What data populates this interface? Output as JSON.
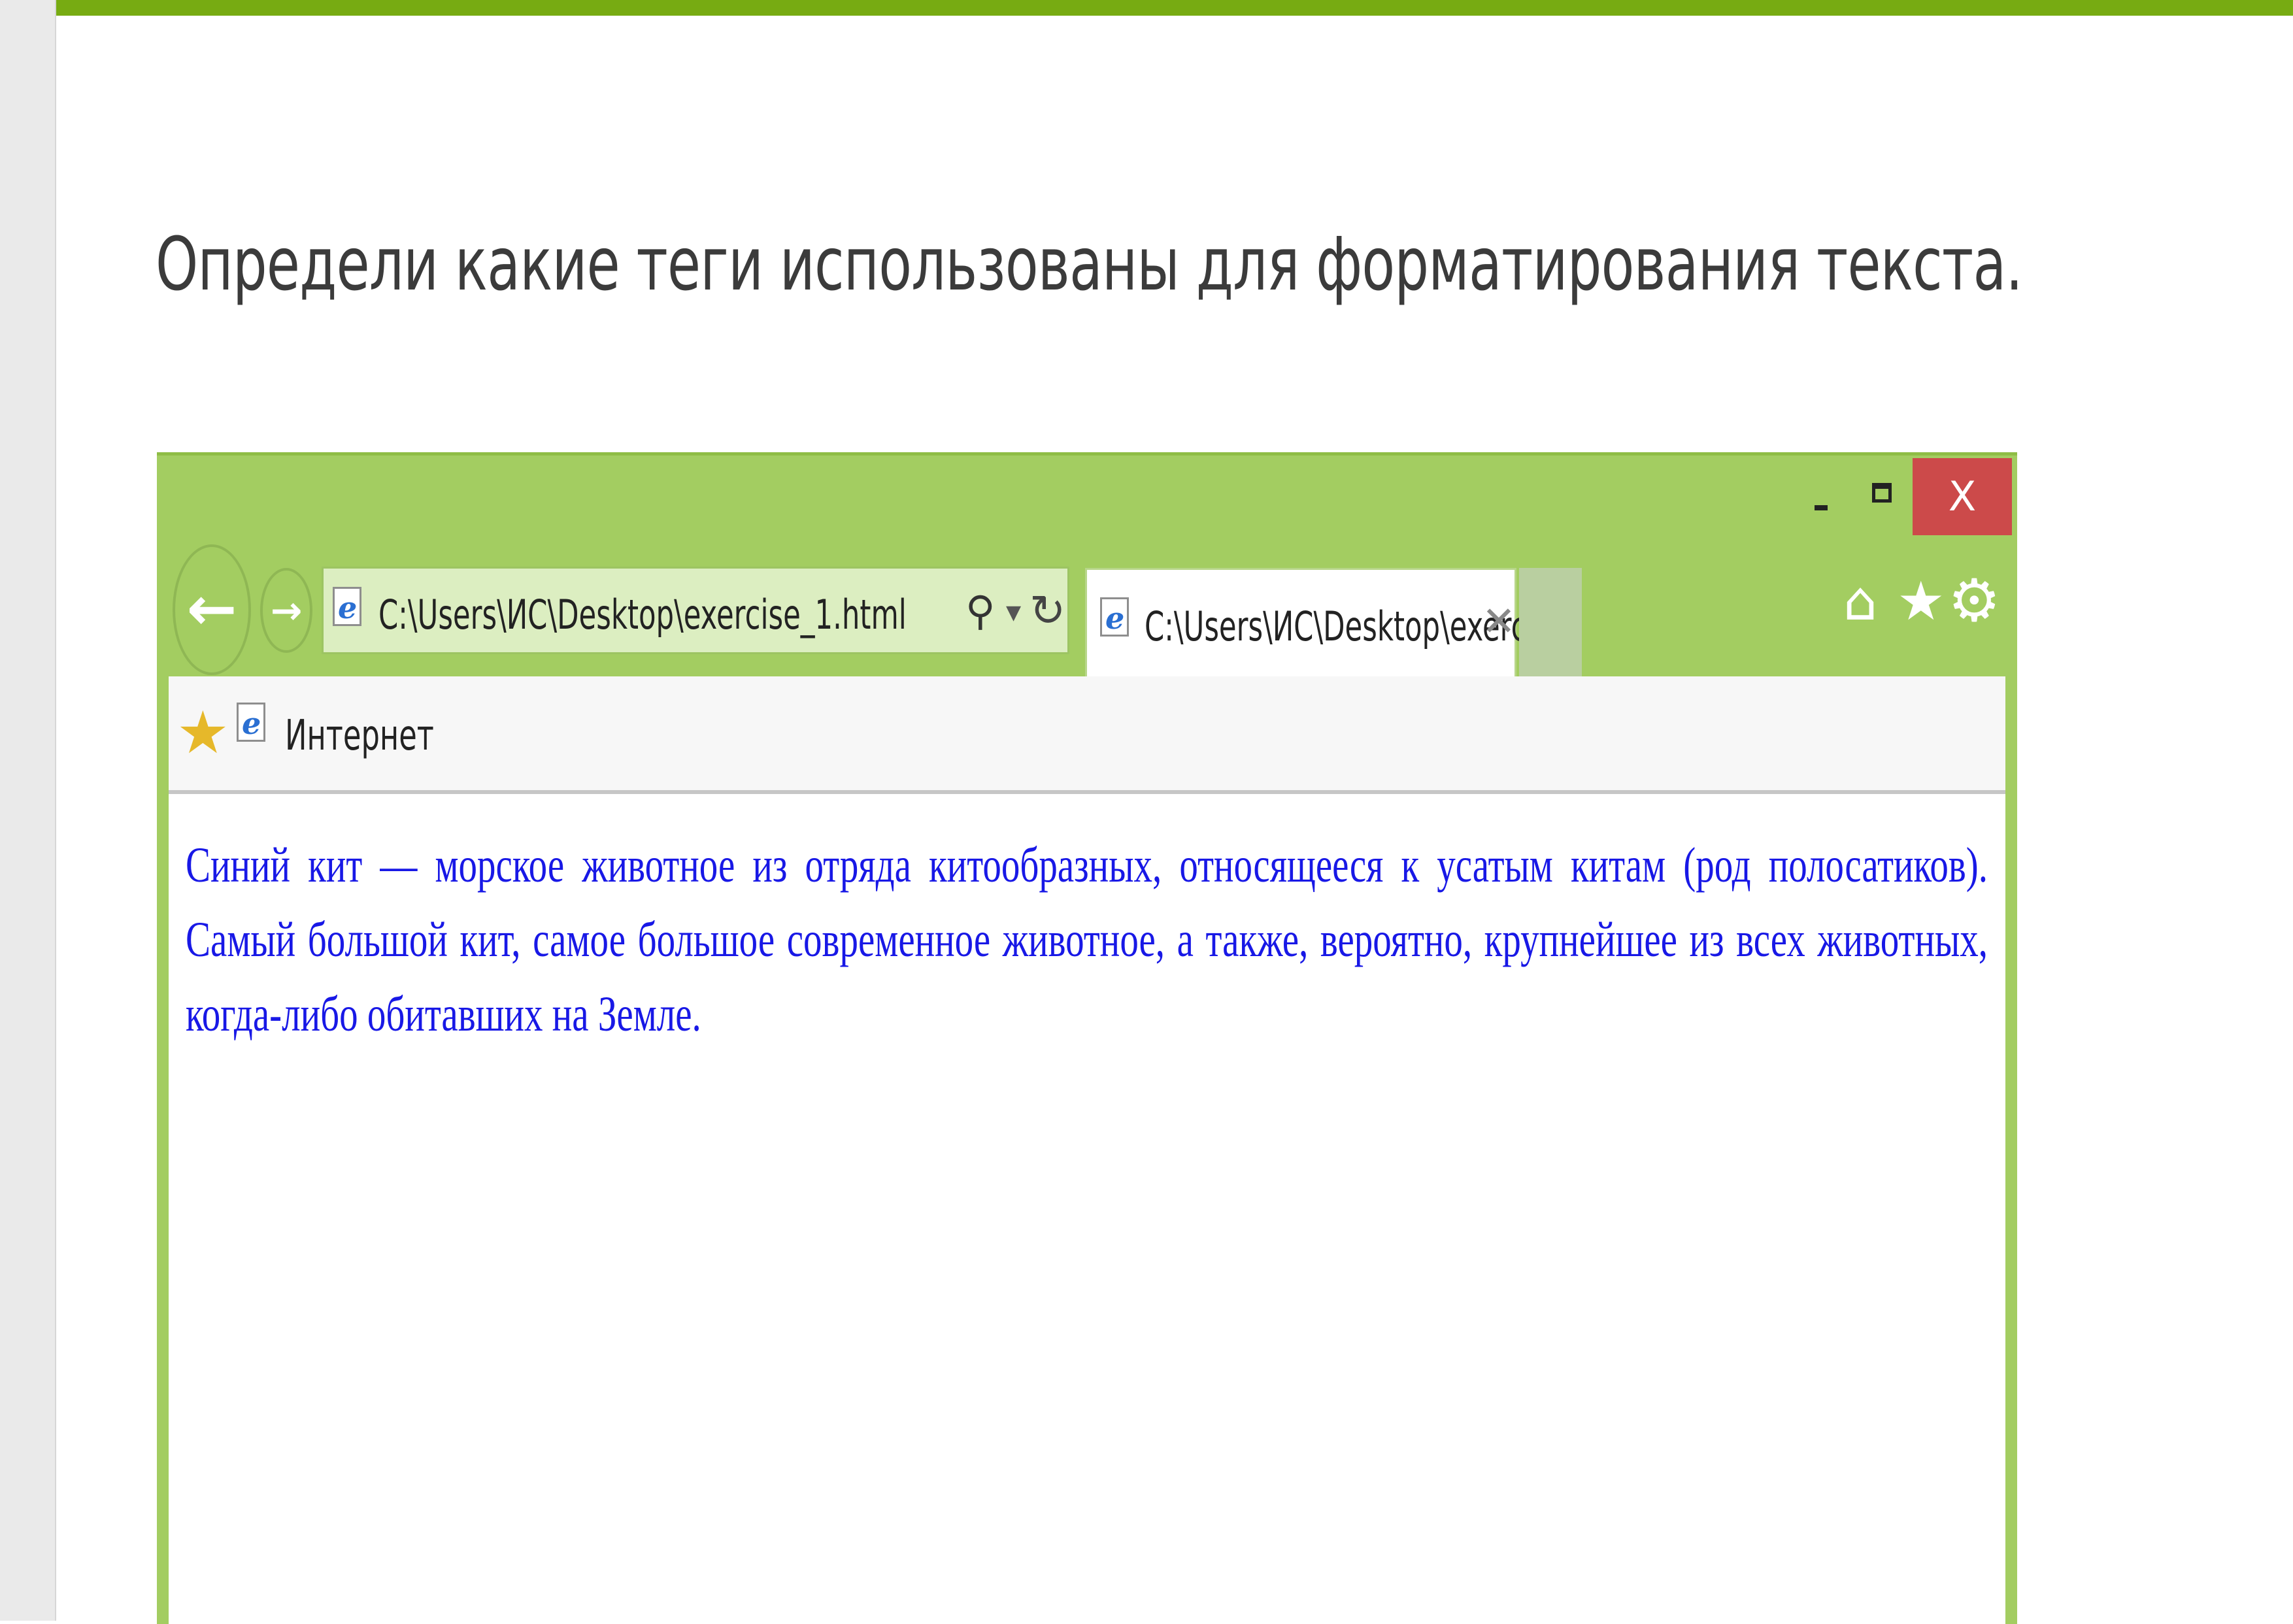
{
  "question": {
    "text": "Определи какие теги использованы для форматирования текста."
  },
  "window_controls": {
    "close_label": "X"
  },
  "address_bar": {
    "url": "C:\\Users\\ИС\\Desktop\\exercise_1.html"
  },
  "tab": {
    "title": "C:\\Users\\ИС\\Desktop\\exerc...",
    "close_label": "✕"
  },
  "favorites_bar": {
    "label": "Интернет"
  },
  "content": {
    "paragraph": "Синий кит — морское животное из отряда китообразных, относящееся к усатым китам (род полосатиков). Самый большой кит, самое большое современное животное, а также, вероятно, крупнейшее из всех животных, когда-либо обитавших на Земле."
  },
  "icons": {
    "back": "back-arrow-icon",
    "forward": "forward-arrow-icon",
    "search": "search-icon",
    "refresh": "refresh-icon",
    "home": "home-icon",
    "favorites": "star-icon",
    "settings": "gear-icon",
    "page": "ie-page-icon"
  },
  "colors": {
    "accent_bar": "#77ab12",
    "browser_frame": "#a3cd61",
    "close_button": "#cc4a4a",
    "content_text": "#1818e6"
  }
}
